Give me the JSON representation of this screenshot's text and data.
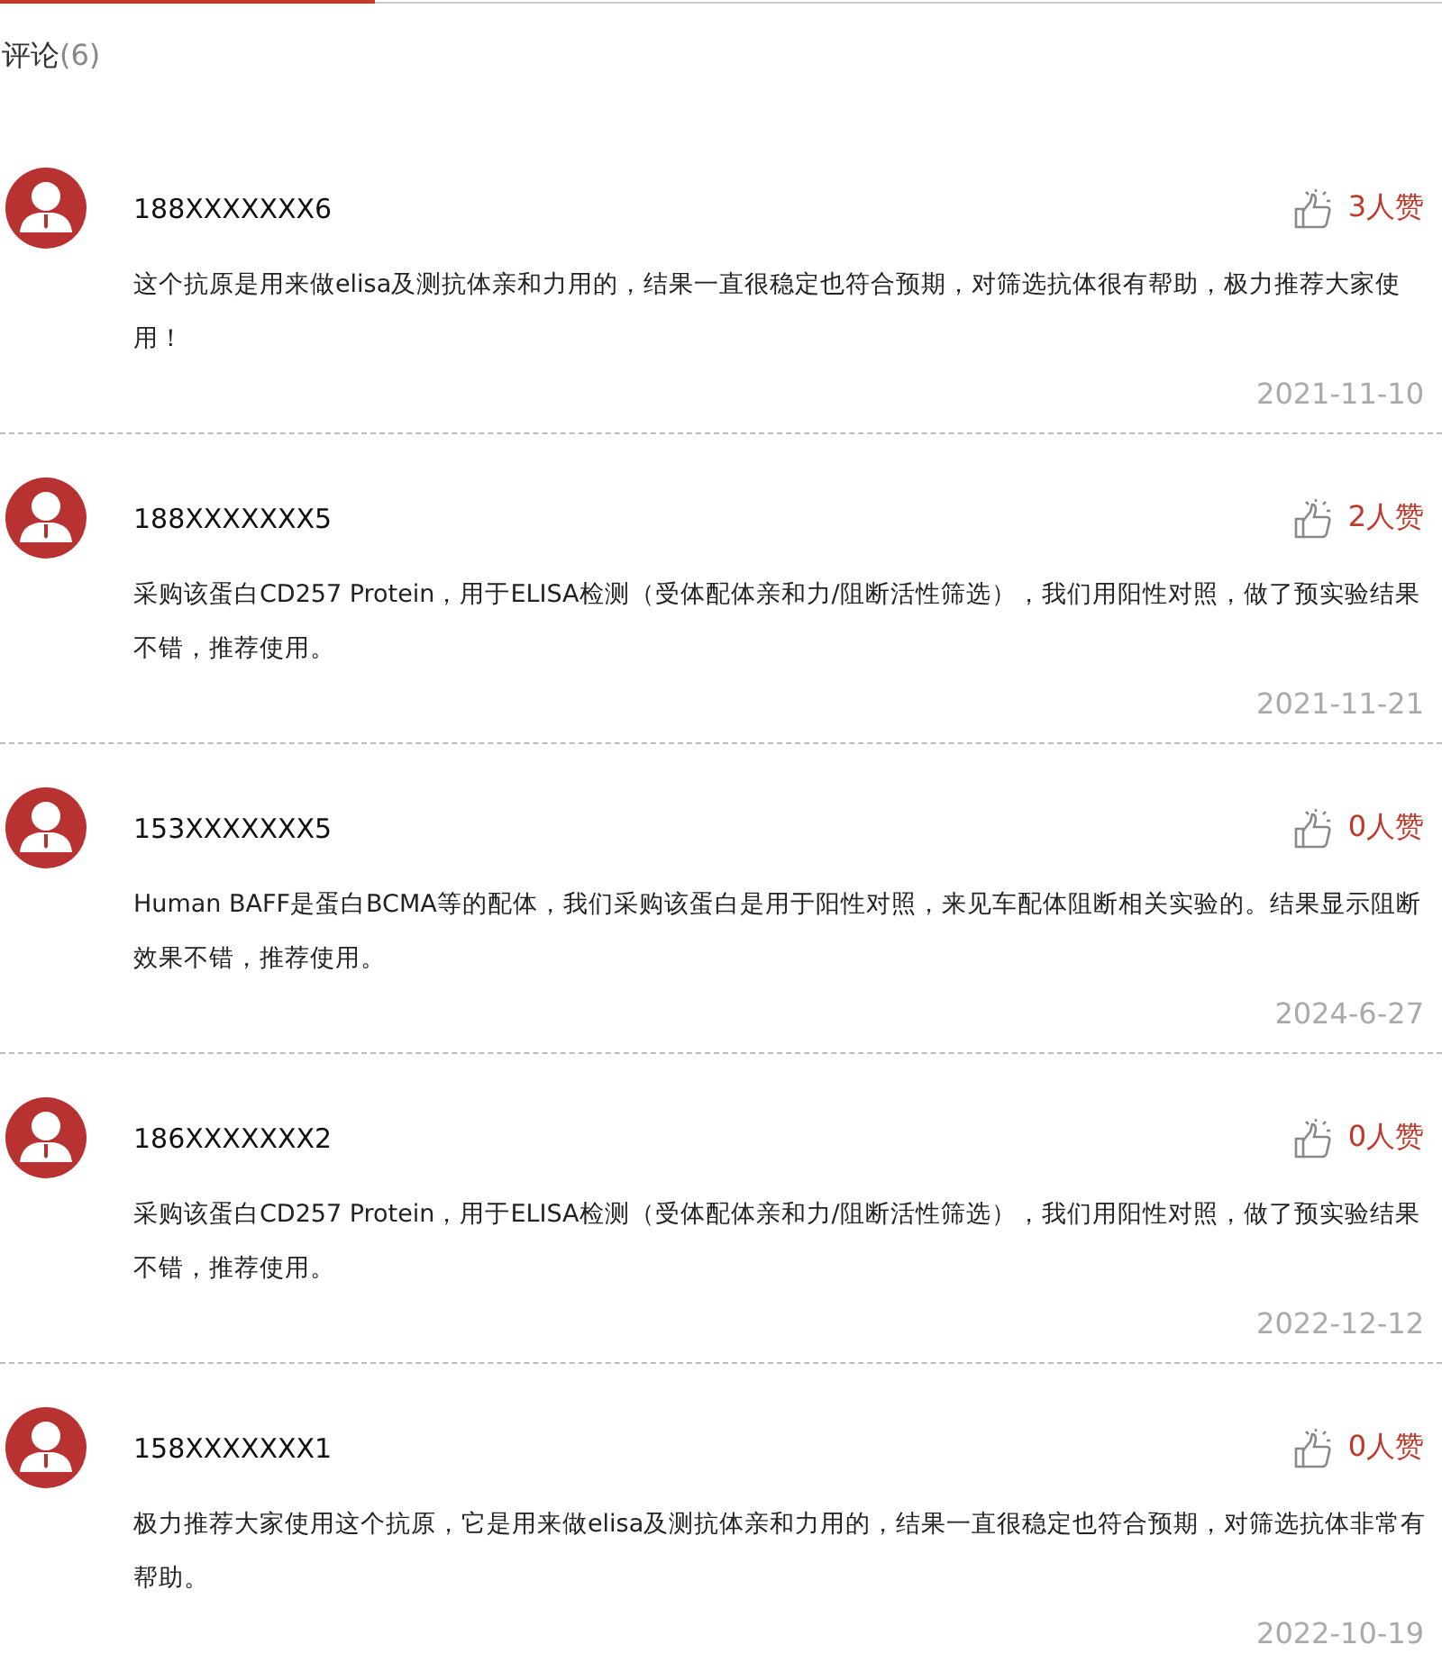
{
  "header": {
    "title": "评论",
    "count": "(6)"
  },
  "comments": [
    {
      "user": "188XXXXXXX6",
      "likes": "3人赞",
      "text": "这个抗原是用来做elisa及测抗体亲和力用的，结果一直很稳定也符合预期，对筛选抗体很有帮助，极力推荐大家使用！",
      "date": "2021-11-10"
    },
    {
      "user": "188XXXXXXX5",
      "likes": "2人赞",
      "text": "采购该蛋白CD257 Protein，用于ELISA检测（受体配体亲和力/阻断活性筛选），我们用阳性对照，做了预实验结果不错，推荐使用。",
      "date": "2021-11-21"
    },
    {
      "user": "153XXXXXXX5",
      "likes": "0人赞",
      "text": "Human BAFF是蛋白BCMA等的配体，我们采购该蛋白是用于阳性对照，来见车配体阻断相关实验的。结果显示阻断效果不错，推荐使用。",
      "date": "2024-6-27"
    },
    {
      "user": "186XXXXXXX2",
      "likes": "0人赞",
      "text": "采购该蛋白CD257 Protein，用于ELISA检测（受体配体亲和力/阻断活性筛选），我们用阳性对照，做了预实验结果不错，推荐使用。",
      "date": "2022-12-12"
    },
    {
      "user": "158XXXXXXX1",
      "likes": "0人赞",
      "text": "极力推荐大家使用这个抗原，它是用来做elisa及测抗体亲和力用的，结果一直很稳定也符合预期，对筛选抗体非常有帮助。",
      "date": "2022-10-19"
    }
  ]
}
